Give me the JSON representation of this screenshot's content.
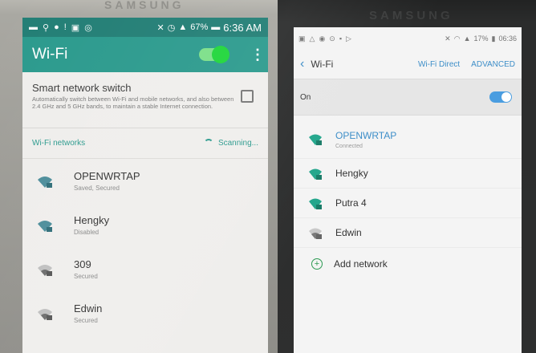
{
  "left_phone": {
    "brand": "SAMSUNG",
    "status_bar": {
      "battery": "67%",
      "time": "6:36 AM"
    },
    "app_bar": {
      "title": "Wi-Fi",
      "toggle_on": true,
      "menu_icon": "kebab-menu-icon"
    },
    "smart_switch": {
      "title": "Smart network switch",
      "description": "Automatically switch between Wi-Fi and mobile networks, and also between 2.4 GHz and 5 GHz bands, to maintain a stable Internet connection.",
      "checked": false
    },
    "networks_header": {
      "label": "Wi-Fi networks",
      "status": "Scanning..."
    },
    "networks": [
      {
        "name": "OPENWRTAP",
        "status": "Saved, Secured",
        "signal": "strong"
      },
      {
        "name": "Hengky",
        "status": "Disabled",
        "signal": "strong"
      },
      {
        "name": "309",
        "status": "Secured",
        "signal": "weak"
      },
      {
        "name": "Edwin",
        "status": "Secured",
        "signal": "weak"
      }
    ],
    "colors": {
      "accent": "#2b9a8d",
      "status_bar": "#227e75",
      "toggle": "#1fd63a"
    }
  },
  "right_phone": {
    "brand": "SAMSUNG",
    "status_bar": {
      "battery": "17%",
      "time": "06:36"
    },
    "app_bar": {
      "title": "Wi-Fi",
      "wifi_direct": "Wi-Fi Direct",
      "advanced": "ADVANCED"
    },
    "master_switch": {
      "label": "On",
      "toggle_on": true
    },
    "networks": [
      {
        "name": "OPENWRTAP",
        "status": "Connected",
        "signal": "strong",
        "connected": true
      },
      {
        "name": "Hengky",
        "status": "",
        "signal": "strong",
        "connected": false
      },
      {
        "name": "Putra 4",
        "status": "",
        "signal": "strong",
        "connected": false
      },
      {
        "name": "Edwin",
        "status": "",
        "signal": "weak",
        "connected": false
      }
    ],
    "add_network": "Add network",
    "colors": {
      "accent": "#3d8ec8",
      "wifi_icon": "#23a68c",
      "add_icon": "#2c9a52"
    }
  }
}
